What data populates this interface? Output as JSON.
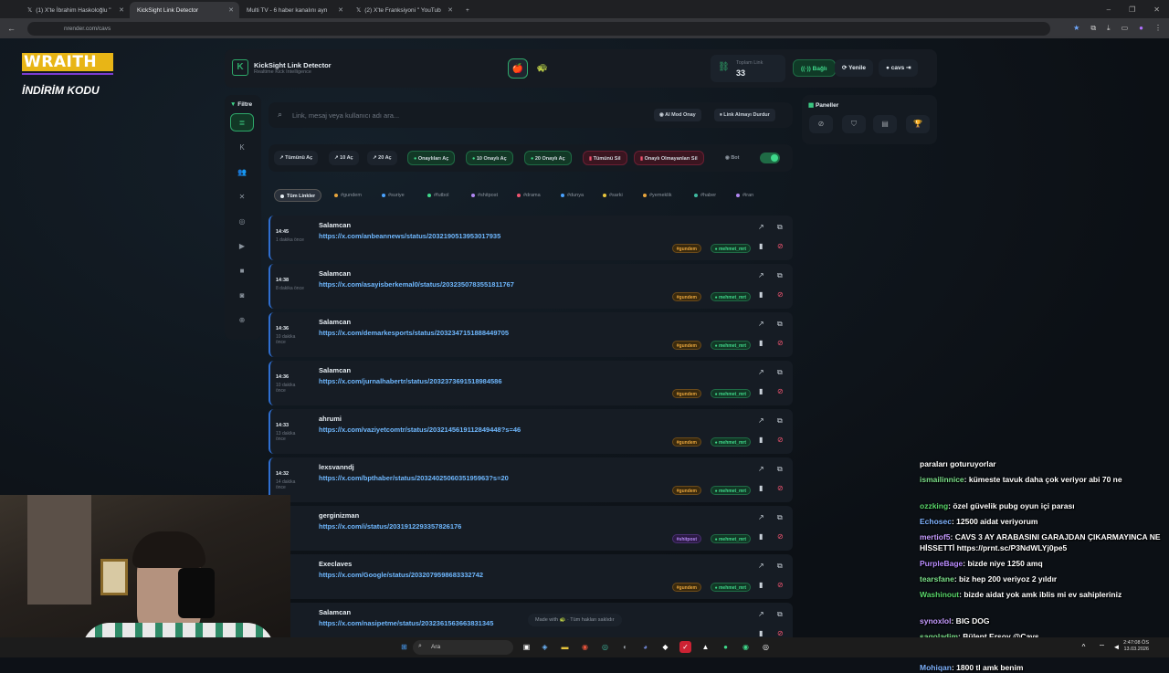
{
  "browser": {
    "tabs": [
      {
        "label": "(1) X'te İbrahim Haskoloğlu \"",
        "active": false
      },
      {
        "label": "KickSight Link Detector",
        "active": true
      },
      {
        "label": "Multi TV - 6 haber kanalını ayn",
        "active": false
      },
      {
        "label": "(2) X'te Franksiyoni \" YouTub",
        "active": false
      }
    ],
    "url": "nrender.com/cavs"
  },
  "overlay": {
    "wraith": "WRAITH",
    "indirim": "İNDİRİM KODU"
  },
  "app": {
    "title": "KickSight Link Detector",
    "subtitle": "Realtime Kick Intelligence",
    "stat_label": "Toplam Link",
    "stat_value": "33",
    "connected": "Bağlı",
    "refresh": "Yenile",
    "user": "cavs"
  },
  "sidebar": {
    "filter_label": "Filtre"
  },
  "search": {
    "placeholder": "Link, mesaj veya kullanıcı adı ara...",
    "ai_mode": "AI Mod Onay",
    "stop": "Link Almayı Durdur"
  },
  "actions": {
    "open_all": "Tümünü Aç",
    "open10": "10 Aç",
    "open20": "20 Aç",
    "open_approved": "Onaylıları Aç",
    "open10_approved": "10 Onaylı Aç",
    "open20_approved": "20 Onaylı Aç",
    "delete_all": "Tümünü Sil",
    "delete_unapproved": "Onaylı Olmayanları Sil",
    "bot": "Bot"
  },
  "tags": [
    {
      "label": "Tüm Linkler",
      "color": "",
      "active": true
    },
    {
      "label": "#gundem",
      "color": "#e8a53c"
    },
    {
      "label": "#suriye",
      "color": "#4aa3ff"
    },
    {
      "label": "#futbol",
      "color": "#3fd98b"
    },
    {
      "label": "#shitpost",
      "color": "#b187f2"
    },
    {
      "label": "#drama",
      "color": "#f05470"
    },
    {
      "label": "#dunya",
      "color": "#4aa3ff"
    },
    {
      "label": "#sarki",
      "color": "#e8c53c"
    },
    {
      "label": "#yemeklik",
      "color": "#e8a53c"
    },
    {
      "label": "#haber",
      "color": "#3fb9a0"
    },
    {
      "label": "#iran",
      "color": "#b187f2"
    }
  ],
  "links": [
    {
      "time": "14:45",
      "ago": "1 dakika önce",
      "user": "Salamcan",
      "url": "https://x.com/anbeannews/status/2032190513953017935",
      "tag": "#gundem",
      "tagtype": "gundem",
      "mod": "mehmet_mrt"
    },
    {
      "time": "14:38",
      "ago": "8 dakika önce",
      "user": "Salamcan",
      "url": "https://x.com/asayisberkemal0/status/2032350783551811767",
      "tag": "#gundem",
      "tagtype": "gundem",
      "mod": "mehmet_mrt"
    },
    {
      "time": "14:36",
      "ago": "10 dakika önce",
      "user": "Salamcan",
      "url": "https://x.com/demarkesports/status/2032347151888449705",
      "tag": "#gundem",
      "tagtype": "gundem",
      "mod": "mehmet_mrt"
    },
    {
      "time": "14:36",
      "ago": "10 dakika önce",
      "user": "Salamcan",
      "url": "https://x.com/jurnalhabertr/status/2032373691518984586",
      "tag": "#gundem",
      "tagtype": "gundem",
      "mod": "mehmet_mrt"
    },
    {
      "time": "14:33",
      "ago": "13 dakika önce",
      "user": "ahrumi",
      "url": "https://x.com/vaziyetcomtr/status/2032145619112849448?s=46",
      "tag": "#gundem",
      "tagtype": "gundem",
      "mod": "mehmet_mrt"
    },
    {
      "time": "14:32",
      "ago": "14 dakika önce",
      "user": "lexsvanndj",
      "url": "https://x.com/bpthaber/status/2032402506035195963?s=20",
      "tag": "#gundem",
      "tagtype": "gundem",
      "mod": "mehmet_mrt"
    },
    {
      "time": "",
      "ago": "",
      "user": "gerginizman",
      "url": "https://x.com/i/status/2031912293357826176",
      "tag": "#shitpost",
      "tagtype": "shitpost",
      "mod": "mehmet_mrt"
    },
    {
      "time": "",
      "ago": "",
      "user": "Execlaves",
      "url": "https://x.com/Google/status/2032079598683332742",
      "tag": "#gundem",
      "tagtype": "gundem",
      "mod": "mehmet_mrt"
    },
    {
      "time": "",
      "ago": "",
      "user": "Salamcan",
      "url": "https://x.com/nasipetme/status/2032361563663831345",
      "tag": "",
      "tagtype": "none",
      "mod": ""
    }
  ],
  "panel": {
    "label": "Paneller"
  },
  "footer": "Made with 🐢 · Tüm hakları saklıdır",
  "chat": [
    {
      "name": "",
      "color": "#ffffff",
      "text": "paraları goturuyorlar"
    },
    {
      "name": "ismailinnice",
      "color": "#7be08a",
      "text": ": kümeste tavuk daha çok veriyor abi 70 ne"
    },
    {
      "name": "ozzking",
      "color": "#58d66a",
      "text": ": özel güvelik pubg oyun içi parası"
    },
    {
      "name": "Echosec",
      "color": "#7fb3ff",
      "text": ": 12500 aidat veriyorum"
    },
    {
      "name": "mertiof5",
      "color": "#c59bff",
      "text": ": CAVS 3 AY ARABASINI GARAJDAN ÇIKARMAYINCA NE HİSSETTİ https://prnt.sc/P3NdWLYj0pe5"
    },
    {
      "name": "PurpleBage",
      "color": "#b98cff",
      "text": ": bizde niye 1250 amq"
    },
    {
      "name": "tearsfane",
      "color": "#7be08a",
      "text": ": biz hep 200 veriyoz 2 yıldır"
    },
    {
      "name": "Washinout",
      "color": "#58d66a",
      "text": ": bizde aidat yok amk iblis mi ev sahipleriniz"
    },
    {
      "name": "synoxlol",
      "color": "#c59bff",
      "text": ": BIG DOG"
    },
    {
      "name": "sagoladim",
      "color": "#7be08a",
      "text": ": Bülent Ersoy @Cavs"
    },
    {
      "name": "rever1of1",
      "color": "#7fb3ff",
      "text": ": otis"
    },
    {
      "name": "Mohiqan",
      "color": "#7fb3ff",
      "text": ": 1800 tl amk benim"
    }
  ],
  "taskbar": {
    "search": "Ara",
    "time": "2:47:08 ÖS",
    "date": "13.03.2026"
  }
}
